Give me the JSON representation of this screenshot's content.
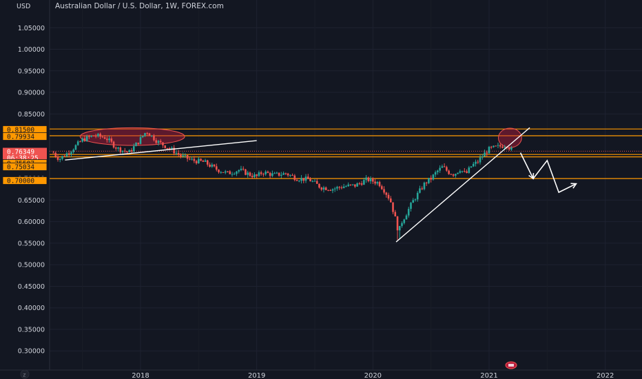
{
  "header": {
    "unit_label": "USD",
    "title": "Australian Dollar / U.S. Dollar, 1W, FOREX.com"
  },
  "footer": {
    "scale_icon": "z-icon"
  },
  "colors": {
    "background": "#131722",
    "grid": "#1e2230",
    "up": "#26a69a",
    "down": "#ef5350",
    "level": "#ff9800",
    "drawing": "#ffffff",
    "highlight_fill": "#b71c3c",
    "price_tag": "#ef5350",
    "axis_text": "#d1d4dc"
  },
  "chart_data": {
    "type": "candlestick",
    "title": "Australian Dollar / U.S. Dollar, 1W, FOREX.com",
    "xlabel": "",
    "ylabel": "USD",
    "ylim": [
      0.27,
      1.1
    ],
    "xlim": [
      2017.25,
      2022.35
    ],
    "grid": true,
    "y_ticks": [
      "0.30000",
      "0.35000",
      "0.40000",
      "0.45000",
      "0.50000",
      "0.55000",
      "0.60000",
      "0.65000",
      "0.70000",
      "0.75000",
      "0.80000",
      "0.85000",
      "0.90000",
      "0.95000",
      "1.00000",
      "1.05000"
    ],
    "y_tick_values": [
      0.3,
      0.35,
      0.4,
      0.45,
      0.5,
      0.55,
      0.6,
      0.65,
      0.7,
      0.75,
      0.8,
      0.85,
      0.9,
      0.95,
      1.0,
      1.05
    ],
    "x_ticks": [
      "2018",
      "2019",
      "2020",
      "2021",
      "2022"
    ],
    "x_tick_values": [
      2018,
      2019,
      2020,
      2021,
      2022
    ],
    "price_tags": [
      {
        "label": "0.81500",
        "value": 0.815,
        "style": "level"
      },
      {
        "label": "0.79934",
        "value": 0.79934,
        "style": "level"
      },
      {
        "label": "0.76349",
        "value": 0.76349,
        "style": "current"
      },
      {
        "label": "06:38:25",
        "value": 0.7545,
        "style": "countdown"
      },
      {
        "label": "0.75587",
        "value": 0.75587,
        "style": "level"
      },
      {
        "label": "0.75034",
        "value": 0.75034,
        "style": "level"
      },
      {
        "label": "0.70000",
        "value": 0.7,
        "style": "level"
      }
    ],
    "horizontal_levels": [
      0.815,
      0.79934,
      0.75587,
      0.75034,
      0.7
    ],
    "price_path": [
      [
        2017.25,
        0.76
      ],
      [
        2017.3,
        0.745
      ],
      [
        2017.4,
        0.765
      ],
      [
        2017.5,
        0.79
      ],
      [
        2017.6,
        0.8
      ],
      [
        2017.7,
        0.795
      ],
      [
        2017.8,
        0.77
      ],
      [
        2017.9,
        0.76
      ],
      [
        2017.98,
        0.785
      ],
      [
        2018.05,
        0.81
      ],
      [
        2018.15,
        0.785
      ],
      [
        2018.25,
        0.77
      ],
      [
        2018.35,
        0.752
      ],
      [
        2018.45,
        0.742
      ],
      [
        2018.55,
        0.738
      ],
      [
        2018.65,
        0.722
      ],
      [
        2018.75,
        0.712
      ],
      [
        2018.85,
        0.72
      ],
      [
        2018.95,
        0.708
      ],
      [
        2019.0,
        0.705
      ],
      [
        2019.05,
        0.715
      ],
      [
        2019.15,
        0.708
      ],
      [
        2019.25,
        0.712
      ],
      [
        2019.35,
        0.7
      ],
      [
        2019.45,
        0.698
      ],
      [
        2019.55,
        0.68
      ],
      [
        2019.65,
        0.676
      ],
      [
        2019.75,
        0.682
      ],
      [
        2019.85,
        0.684
      ],
      [
        2019.95,
        0.698
      ],
      [
        2020.05,
        0.69
      ],
      [
        2020.1,
        0.672
      ],
      [
        2020.15,
        0.65
      ],
      [
        2020.2,
        0.6
      ],
      [
        2020.22,
        0.575
      ],
      [
        2020.25,
        0.6
      ],
      [
        2020.3,
        0.625
      ],
      [
        2020.35,
        0.65
      ],
      [
        2020.4,
        0.67
      ],
      [
        2020.45,
        0.69
      ],
      [
        2020.5,
        0.7
      ],
      [
        2020.55,
        0.716
      ],
      [
        2020.6,
        0.727
      ],
      [
        2020.65,
        0.715
      ],
      [
        2020.7,
        0.71
      ],
      [
        2020.75,
        0.722
      ],
      [
        2020.8,
        0.71
      ],
      [
        2020.85,
        0.73
      ],
      [
        2020.9,
        0.738
      ],
      [
        2020.95,
        0.755
      ],
      [
        2021.0,
        0.768
      ],
      [
        2021.05,
        0.772
      ],
      [
        2021.1,
        0.775
      ],
      [
        2021.15,
        0.778
      ],
      [
        2021.18,
        0.77
      ],
      [
        2021.21,
        0.762
      ]
    ],
    "annotations": {
      "ellipses": [
        {
          "x1": 2017.48,
          "x2": 2018.38,
          "y1": 0.777,
          "y2": 0.818
        },
        {
          "x1": 2021.08,
          "x2": 2021.28,
          "y1": 0.772,
          "y2": 0.817
        }
      ],
      "lines": [
        [
          [
            2017.35,
            0.743
          ],
          [
            2019.0,
            0.788
          ]
        ],
        [
          [
            2020.2,
            0.553
          ],
          [
            2021.35,
            0.818
          ]
        ]
      ],
      "arrows": [
        [
          [
            2021.27,
            0.76
          ],
          [
            2021.38,
            0.7
          ],
          [
            2021.5,
            0.742
          ],
          [
            2021.6,
            0.668
          ],
          [
            2021.75,
            0.688
          ]
        ]
      ]
    }
  }
}
